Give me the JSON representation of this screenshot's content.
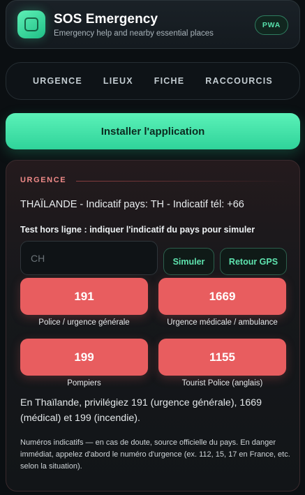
{
  "header": {
    "title": "SOS Emergency",
    "subtitle": "Emergency help and nearby essential places",
    "badge": "PWA",
    "logo_icon": "app-logo-icon"
  },
  "nav": {
    "items": [
      {
        "label": "URGENCE"
      },
      {
        "label": "LIEUX"
      },
      {
        "label": "FICHE"
      },
      {
        "label": "RACCOURCIS"
      }
    ]
  },
  "install": {
    "label": "Installer l'application"
  },
  "emergency": {
    "section_label": "URGENCE",
    "country_line": "THAÏLANDE - Indicatif pays: TH - Indicatif tél: +66",
    "offline_label": "Test hors ligne : indiquer l'indicatif du pays pour simuler",
    "code_input": {
      "value": "",
      "placeholder": "CH"
    },
    "simulate_label": "Simuler",
    "gps_label": "Retour GPS",
    "numbers": [
      {
        "number": "191",
        "caption": "Police / urgence générale"
      },
      {
        "number": "1669",
        "caption": "Urgence médicale / ambulance"
      },
      {
        "number": "199",
        "caption": "Pompiers"
      },
      {
        "number": "1155",
        "caption": "Tourist Police (anglais)"
      }
    ],
    "advice": "En Thaïlande, privilégiez 191 (urgence générale), 1669 (médical) et 199 (incendie).",
    "note": "Numéros indicatifs — en cas de doute, source officielle du pays. En danger immédiat, appelez d'abord le numéro d'urgence (ex. 112, 15, 17 en France, etc. selon la situation)."
  },
  "colors": {
    "accent_green": "#3ddba0",
    "emergency_red": "#e85d5f",
    "background": "#0b0f12"
  }
}
